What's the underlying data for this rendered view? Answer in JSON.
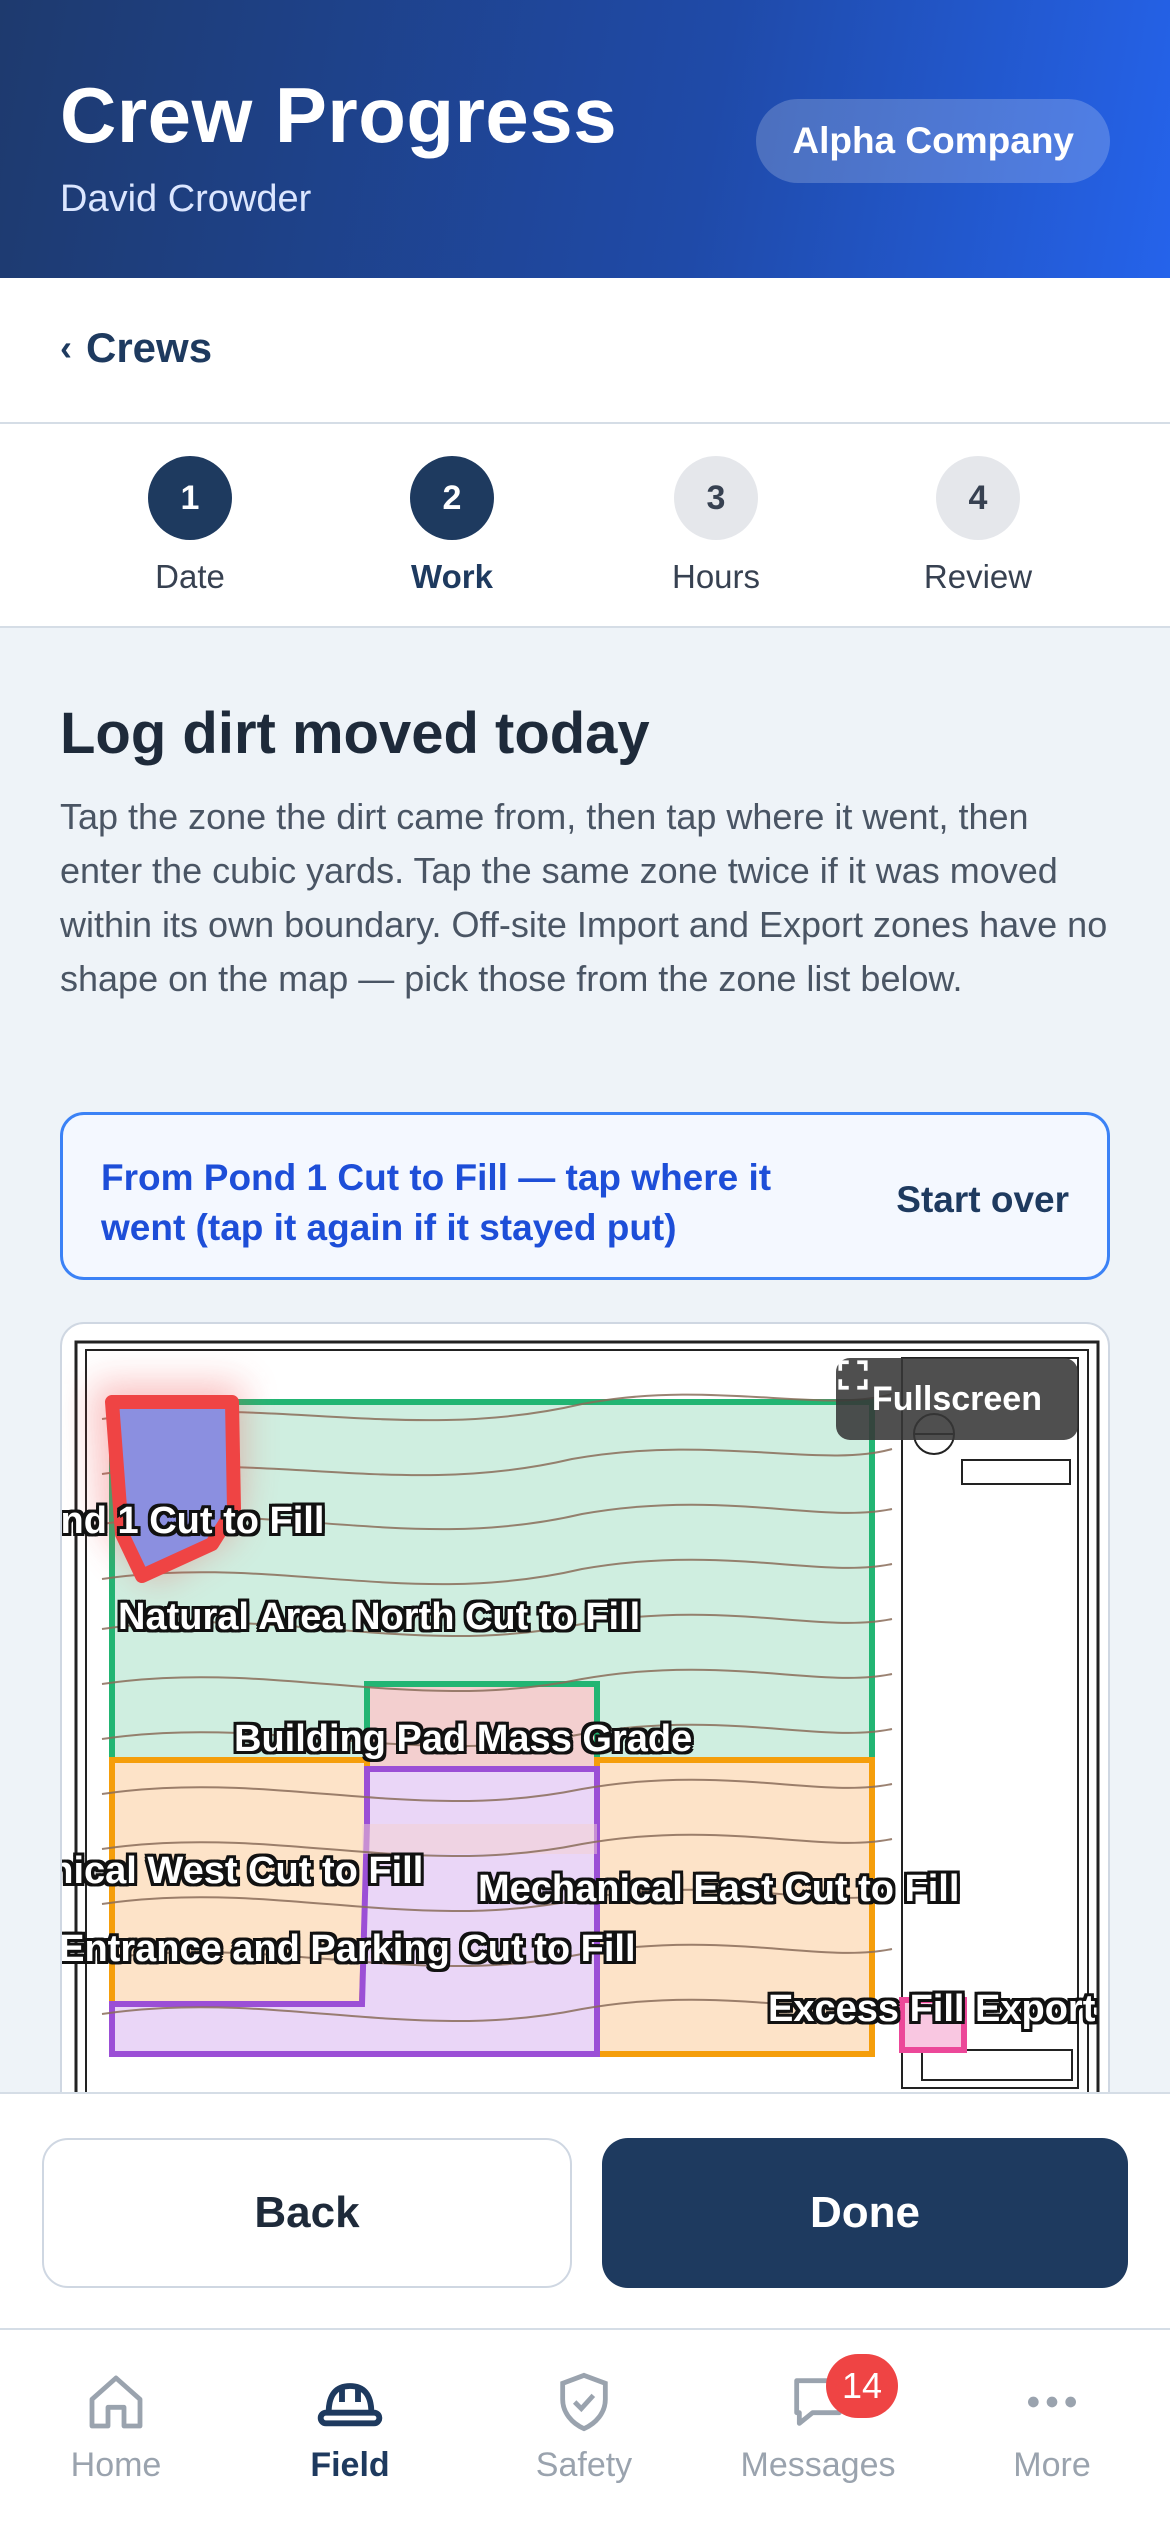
{
  "header": {
    "title": "Crew Progress",
    "subtitle": "David Crowder",
    "company": "Alpha Company"
  },
  "nav": {
    "back_label": "Crews"
  },
  "stepper": {
    "steps": [
      {
        "number": "1",
        "label": "Date",
        "state": "done"
      },
      {
        "number": "2",
        "label": "Work",
        "state": "active"
      },
      {
        "number": "3",
        "label": "Hours",
        "state": "upcoming"
      },
      {
        "number": "4",
        "label": "Review",
        "state": "upcoming"
      }
    ]
  },
  "main": {
    "title": "Log dirt moved today",
    "description": "Tap the zone the dirt came from, then tap where it went, then enter the cubic yards. Tap the same zone twice if it was moved within its own boundary. Off-site Import and Export zones have no shape on the map — pick those from the zone list below.",
    "banner": {
      "message": "From Pond 1 Cut to Fill — tap where it went (tap it again if it stayed put)",
      "action": "Start over"
    },
    "map": {
      "fullscreen_label": "Fullscreen",
      "zones": [
        {
          "label": "Pond 1 Cut to Fill",
          "color": "#8b8fe0",
          "selected": true
        },
        {
          "label": "Natural Area North Cut to Fill",
          "color": "#22b573"
        },
        {
          "label": "Building Pad Mass Grade",
          "color": "#22b573"
        },
        {
          "label": "Mechanical West Cut to Fill",
          "color": "#f59e0b"
        },
        {
          "label": "Mechanical East Cut to Fill",
          "color": "#f59e0b"
        },
        {
          "label": "Main Entrance and Parking Cut to Fill",
          "color": "#9b4fd6"
        },
        {
          "label": "Excess Fill Export",
          "color": "#ec4899"
        }
      ]
    }
  },
  "actions": {
    "back": "Back",
    "done": "Done"
  },
  "tabbar": {
    "items": [
      {
        "label": "Home",
        "icon": "home-icon"
      },
      {
        "label": "Field",
        "icon": "hardhat-icon",
        "active": true
      },
      {
        "label": "Safety",
        "icon": "shield-icon"
      },
      {
        "label": "Messages",
        "icon": "message-icon",
        "badge": "14"
      },
      {
        "label": "More",
        "icon": "more-icon"
      }
    ]
  },
  "colors": {
    "primary": "#1e3a5f",
    "accent": "#2563eb",
    "badge": "#ef4444"
  }
}
